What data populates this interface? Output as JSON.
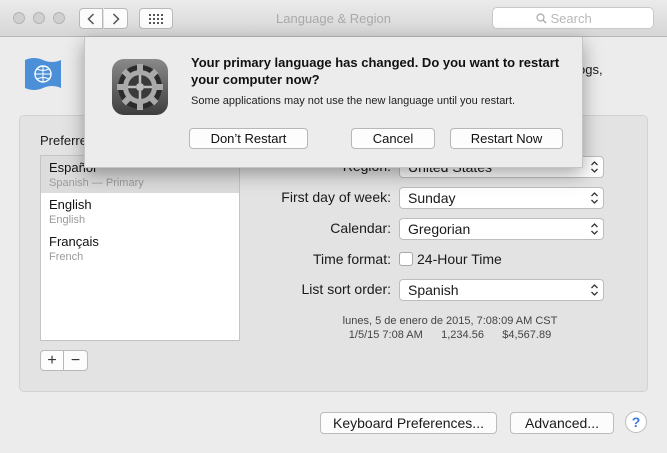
{
  "window": {
    "title": "Language & Region",
    "search_placeholder": "Search",
    "header_text_fragment": "ogs,"
  },
  "preferred": {
    "label": "Preferre",
    "languages": [
      {
        "name": "Español",
        "sub": "Spanish — Primary"
      },
      {
        "name": "English",
        "sub": "English"
      },
      {
        "name": "Français",
        "sub": "French"
      }
    ],
    "add_label": "+",
    "remove_label": "−"
  },
  "settings": {
    "region_label": "Region:",
    "region_value": "United States",
    "first_day_label": "First day of week:",
    "first_day_value": "Sunday",
    "calendar_label": "Calendar:",
    "calendar_value": "Gregorian",
    "time_format_label": "Time format:",
    "time_format_checkbox": "24-Hour Time",
    "sort_label": "List sort order:",
    "sort_value": "Spanish",
    "sample_long": "lunes, 5 de enero de 2015, 7:08:09 AM CST",
    "sample_short": "1/5/15 7:08 AM      1,234.56      $4,567.89"
  },
  "buttons": {
    "keyboard": "Keyboard Preferences...",
    "advanced": "Advanced...",
    "help": "?"
  },
  "sheet": {
    "title": "Your primary language has changed. Do you want to restart your computer now?",
    "message": "Some applications may not use the new language until you restart.",
    "dont_restart": "Don’t Restart",
    "cancel": "Cancel",
    "restart_now": "Restart Now"
  }
}
